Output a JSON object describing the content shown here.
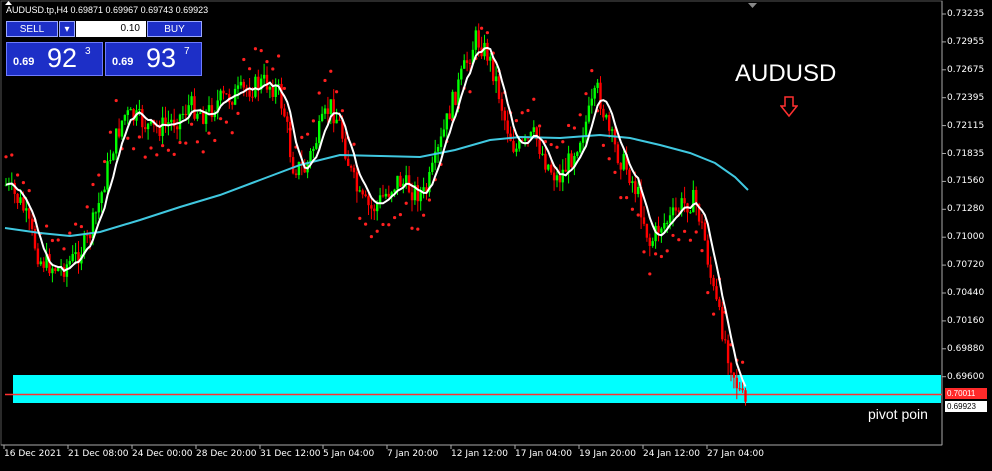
{
  "header": {
    "symbol_line": "AUDUSD.tp,H4  0.69871 0.69967 0.69743 0.69923"
  },
  "trade_panel": {
    "sell_label": "SELL",
    "buy_label": "BUY",
    "lot_value": "0.10",
    "sell_price_prefix": "0.69",
    "sell_price_big": "92",
    "sell_price_sup": "3",
    "buy_price_prefix": "0.69",
    "buy_price_big": "93",
    "buy_price_sup": "7"
  },
  "annotations": {
    "title": "AUDUSD",
    "arrow_icon": "down-arrow-outline",
    "pivot_label": "pivot poin"
  },
  "price_axis": {
    "labels": [
      "0.73235",
      "0.72955",
      "0.72675",
      "0.72395",
      "0.72115",
      "0.71835",
      "0.71560",
      "0.71280",
      "0.71000",
      "0.70720",
      "0.70440",
      "0.70160",
      "0.69880",
      "0.69600"
    ],
    "red_tag": "0.70011",
    "white_tag": "0.69923"
  },
  "time_axis": {
    "labels": [
      "16 Dec 2021",
      "21 Dec 08:00",
      "24 Dec 00:00",
      "28 Dec 20:00",
      "31 Dec 12:00",
      "5 Jan 04:00",
      "7 Jan 20:00",
      "12 Jan 12:00",
      "17 Jan 04:00",
      "19 Jan 20:00",
      "24 Jan 12:00",
      "27 Jan 04:00"
    ]
  },
  "colors": {
    "background": "#000000",
    "bull": "#00ff00",
    "bear": "#ff0000",
    "fast_ma": "#ffffff",
    "slow_ma": "#40c8e0",
    "sar": "#ff2020",
    "pivot_zone": "#00ffff",
    "pivot_line": "#ff3030",
    "title_arrow": "#ff3030"
  }
}
